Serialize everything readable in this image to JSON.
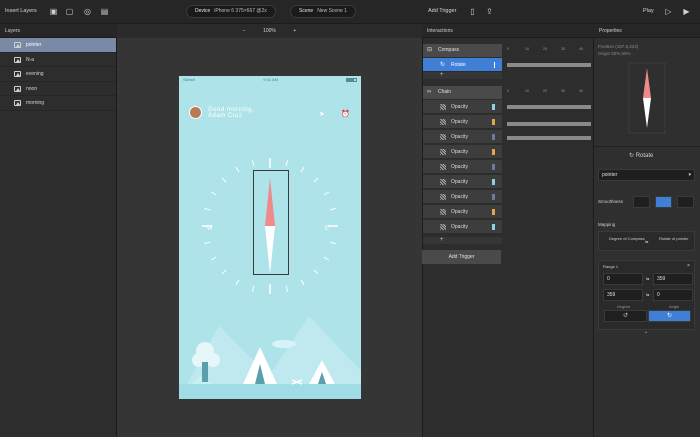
{
  "topbar": {
    "insert_layers": "Insert Layers",
    "device_label": "Device",
    "device_value": "iPhone 6 375×667 @2x",
    "scene_label": "Scene",
    "scene_value": "New Scene 1",
    "add_trigger": "Add Trigger",
    "play": "Play"
  },
  "layers": {
    "title": "Layers",
    "items": [
      "pointer",
      "N-a",
      "evening",
      "noon",
      "morning"
    ]
  },
  "canvas": {
    "zoom_minus": "−",
    "zoom_value": "100%",
    "zoom_plus": "+"
  },
  "phone": {
    "carrier": "Sketch",
    "time": "9:41 AM",
    "greeting_line1": "Good morning,",
    "greeting_line2": "Adam Cruz",
    "compass_w": "W",
    "compass_e": "E"
  },
  "interactions": {
    "title": "Interactions",
    "group1": {
      "name": "Compass",
      "rows": [
        "Rotate"
      ]
    },
    "group2": {
      "name": "Chain",
      "rows": [
        "Opacity",
        "Opacity",
        "Opacity",
        "Opacity",
        "Opacity",
        "Opacity",
        "Opacity",
        "Opacity",
        "Opacity"
      ]
    },
    "plus": "+",
    "ruler": [
      "0",
      "10",
      "20",
      "30",
      "40"
    ],
    "add_trigger": "Add Trigger",
    "swatch_colors": [
      "#8fd0e0",
      "#e8a24a",
      "#6a7aa0",
      "#e8a24a",
      "#6a7aa0",
      "#8fd0e0",
      "#6a7aa0",
      "#e8a24a",
      "#8fd0e0"
    ]
  },
  "properties": {
    "title": "Properties",
    "position": "Position (187.5,333)",
    "origin": "Origin 50%,50%",
    "rotate_title": "Rotate",
    "layer_select": "pointer",
    "smoothness": "Smoothness",
    "mapping": "Mapping",
    "map_from": "Degree of Compass",
    "map_to": "Rotate of pointer",
    "range_label": "Range 1",
    "from_min": "0",
    "to_min": "359",
    "from_max": "359",
    "to_max": "0",
    "degree_label": "Degree",
    "angle_label": "Angle",
    "range_close": "×"
  },
  "colors": {
    "accent": "#3f7fd6",
    "selected_layer": "#7a8aa6",
    "phone_bg": "#aee3ea",
    "needle": "#f08a8a"
  }
}
